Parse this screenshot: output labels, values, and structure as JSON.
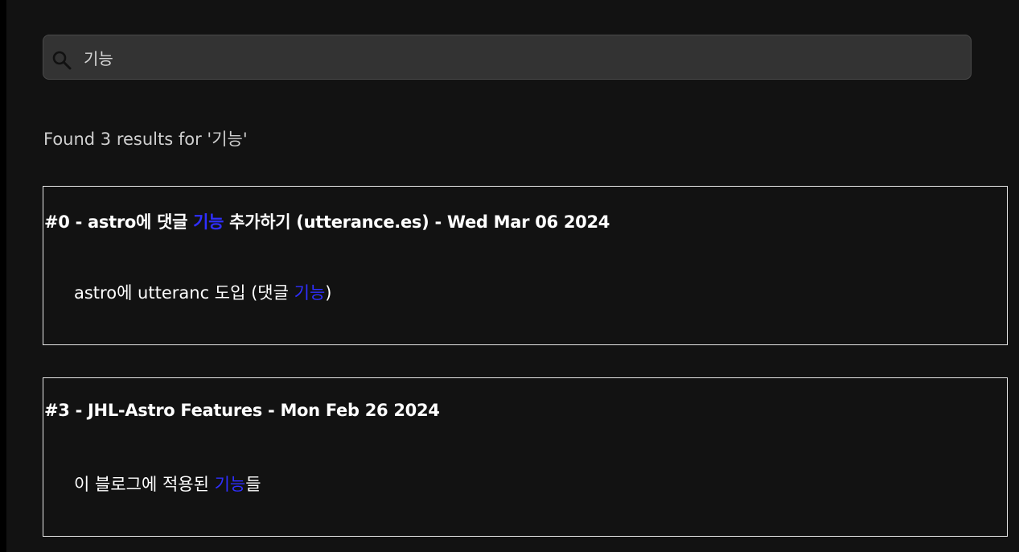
{
  "search": {
    "value": "기능",
    "icon": "search-icon"
  },
  "summary": {
    "text": "Found 3 results for '기능'"
  },
  "colors": {
    "background": "#121212",
    "highlight": "#2f2fff",
    "search_bg": "#333333"
  },
  "results": [
    {
      "title_before": "#0 - astro에 댓글 ",
      "title_match": "기능",
      "title_after": " 추가하기 (utterance.es) - Wed Mar 06 2024",
      "excerpt_before": "astro에 utteranc 도입 (댓글 ",
      "excerpt_match": "기능",
      "excerpt_after": ")"
    },
    {
      "title_before": "#3 - JHL-Astro Features - Mon Feb 26 2024",
      "title_match": "",
      "title_after": "",
      "excerpt_before": "이 블로그에 적용된 ",
      "excerpt_match": "기능",
      "excerpt_after": "들"
    }
  ]
}
